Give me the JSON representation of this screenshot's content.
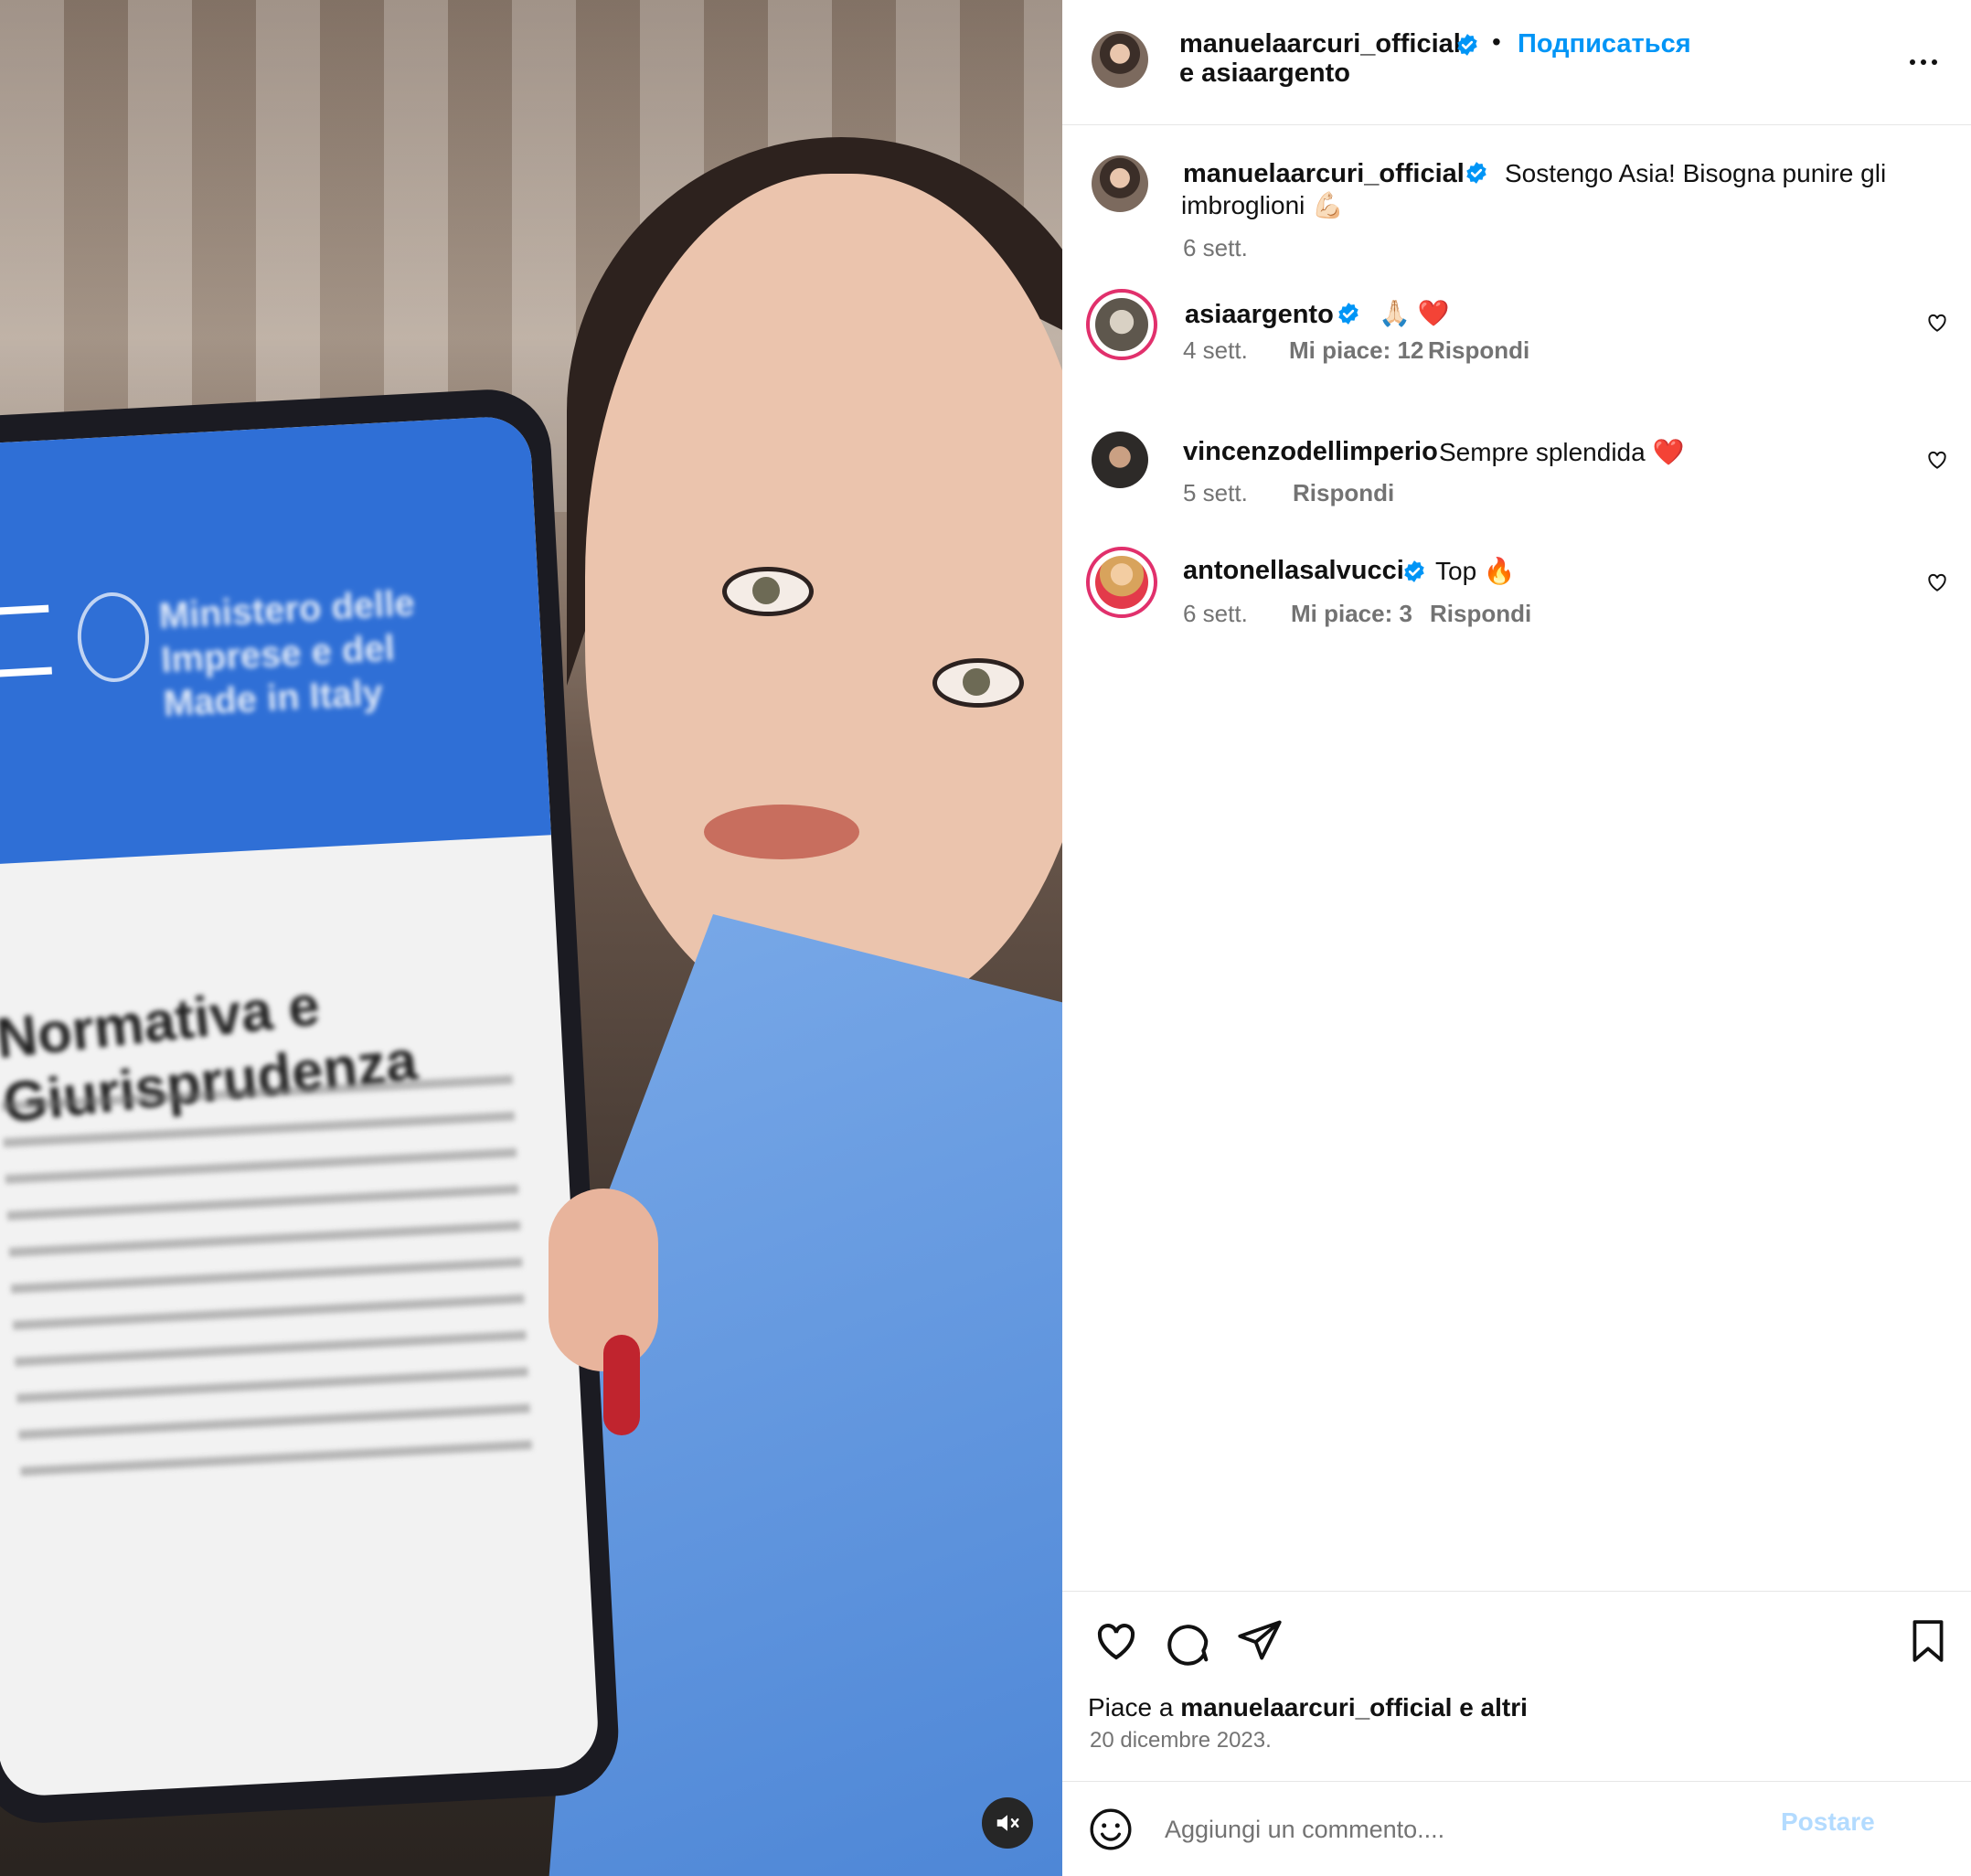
{
  "media": {
    "phone_screen_site": "Ministero delle Imprese e del Made in Italy",
    "phone_screen_title": "Normativa e Giurisprudenza",
    "mute_icon": "speaker-muted-icon"
  },
  "header": {
    "username": "manuelaarcuri_official",
    "separator": "•",
    "follow_label": "Подписаться",
    "collab_line": "e asiaargento",
    "more_icon": "more-horizontal-icon"
  },
  "caption": {
    "username": "manuelaarcuri_official",
    "text": "Sostengo Asia! Bisogna punire gli",
    "text_line2": "imbroglioni 💪🏻",
    "time": "6 sett."
  },
  "comments": [
    {
      "username": "asiaargento",
      "verified": true,
      "text": "🙏🏻 ❤️",
      "time": "4 sett.",
      "likes": "Mi piace: 12",
      "reply": "Rispondi"
    },
    {
      "username": "vincenzodellimperio",
      "verified": false,
      "text": "Sempre splendida ❤️",
      "time": "5 sett.",
      "likes": "",
      "reply": "Rispondi"
    },
    {
      "username": "antonellasalvucci",
      "verified": true,
      "text": "Top 🔥",
      "time": "6 sett.",
      "likes": "Mi piace: 3",
      "reply": "Rispondi"
    }
  ],
  "footer": {
    "liked_prefix": "Piace a",
    "liked_user": "manuelaarcuri_official",
    "liked_suffix": "e altri",
    "date": "20 dicembre 2023.",
    "comment_placeholder": "Aggiungi un commento....",
    "post_label": "Postare"
  },
  "colors": {
    "accent": "#0095f6",
    "verified": "#0095f6",
    "heart_red": "#e0245e",
    "muted_text": "#737373"
  }
}
